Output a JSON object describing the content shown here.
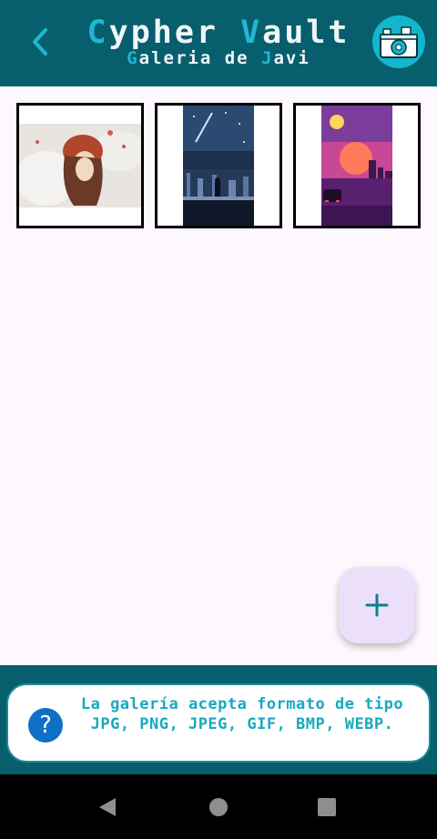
{
  "header": {
    "title_first_letter_1": "C",
    "title_rest_1": "ypher ",
    "title_first_letter_2": "V",
    "title_rest_2": "ault",
    "subtitle_first_letter_1": "G",
    "subtitle_rest_1": "aleria de ",
    "subtitle_first_letter_2": "J",
    "subtitle_rest_2": "avi",
    "back_icon": "chevron-left-icon",
    "logo_icon": "vault-logo-icon"
  },
  "gallery": {
    "images": [
      {
        "name": "anime-girl-wolves"
      },
      {
        "name": "night-city-comet"
      },
      {
        "name": "synthwave-sunset-city"
      }
    ]
  },
  "fab": {
    "label": "+",
    "icon": "plus-icon"
  },
  "info": {
    "text": "La galería acepta formato de tipo JPG, PNG, JPEG, GIF, BMP, WEBP.",
    "icon": "help-icon",
    "icon_glyph": "?"
  },
  "nav": {
    "back_icon": "nav-back-icon",
    "home_icon": "nav-home-icon",
    "recents_icon": "nav-recents-icon"
  },
  "colors": {
    "header_bg": "#075e6c",
    "accent": "#1fb8d2",
    "page_bg": "#fdf8fd",
    "fab_bg": "#ebdffa",
    "info_text": "#17a9c1"
  }
}
